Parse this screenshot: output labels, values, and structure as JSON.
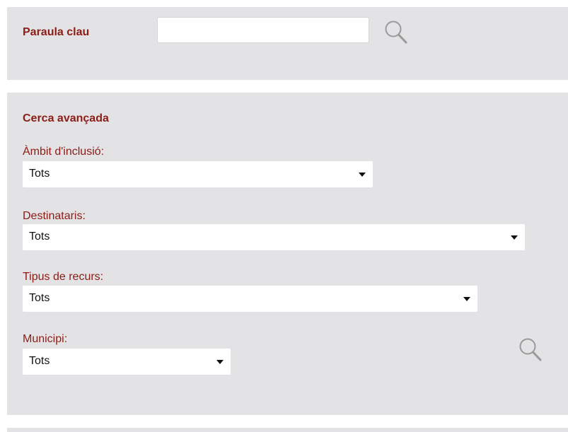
{
  "keyword_search": {
    "label": "Paraula clau",
    "input_value": "",
    "icon": "search-icon"
  },
  "advanced_search": {
    "title": "Cerca avançada",
    "fields": [
      {
        "label": "Àmbit d'inclusió:",
        "value": "Tots"
      },
      {
        "label": "Destinataris:",
        "value": "Tots"
      },
      {
        "label": "Tipus de recurs:",
        "value": "Tots"
      },
      {
        "label": "Municipi:",
        "value": "Tots"
      }
    ],
    "icon": "search-icon"
  },
  "colors": {
    "panel_bg": "#e3e3e5",
    "label": "#8b1c16",
    "icon": "#9a9a9a"
  }
}
